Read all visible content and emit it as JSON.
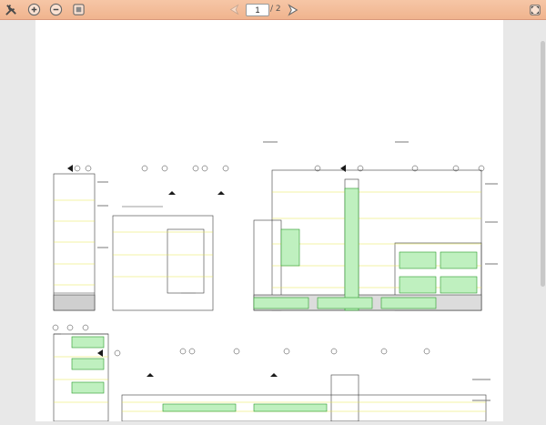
{
  "toolbar": {
    "tools_icon": "tools-icon",
    "zoom_in_icon": "zoom-in-icon",
    "zoom_out_icon": "zoom-out-icon",
    "fit_page_icon": "fit-page-icon",
    "prev_icon": "previous-page-icon",
    "next_icon": "next-page-icon",
    "fullscreen_icon": "fullscreen-icon",
    "current_page": "1",
    "page_total": "/ 2"
  },
  "colors": {
    "toolbar_bg": "#f0b48e",
    "drawing_line": "#3a3a3a",
    "highlight_yellow": "#e8e84a",
    "highlight_green": "#7adf7a"
  }
}
